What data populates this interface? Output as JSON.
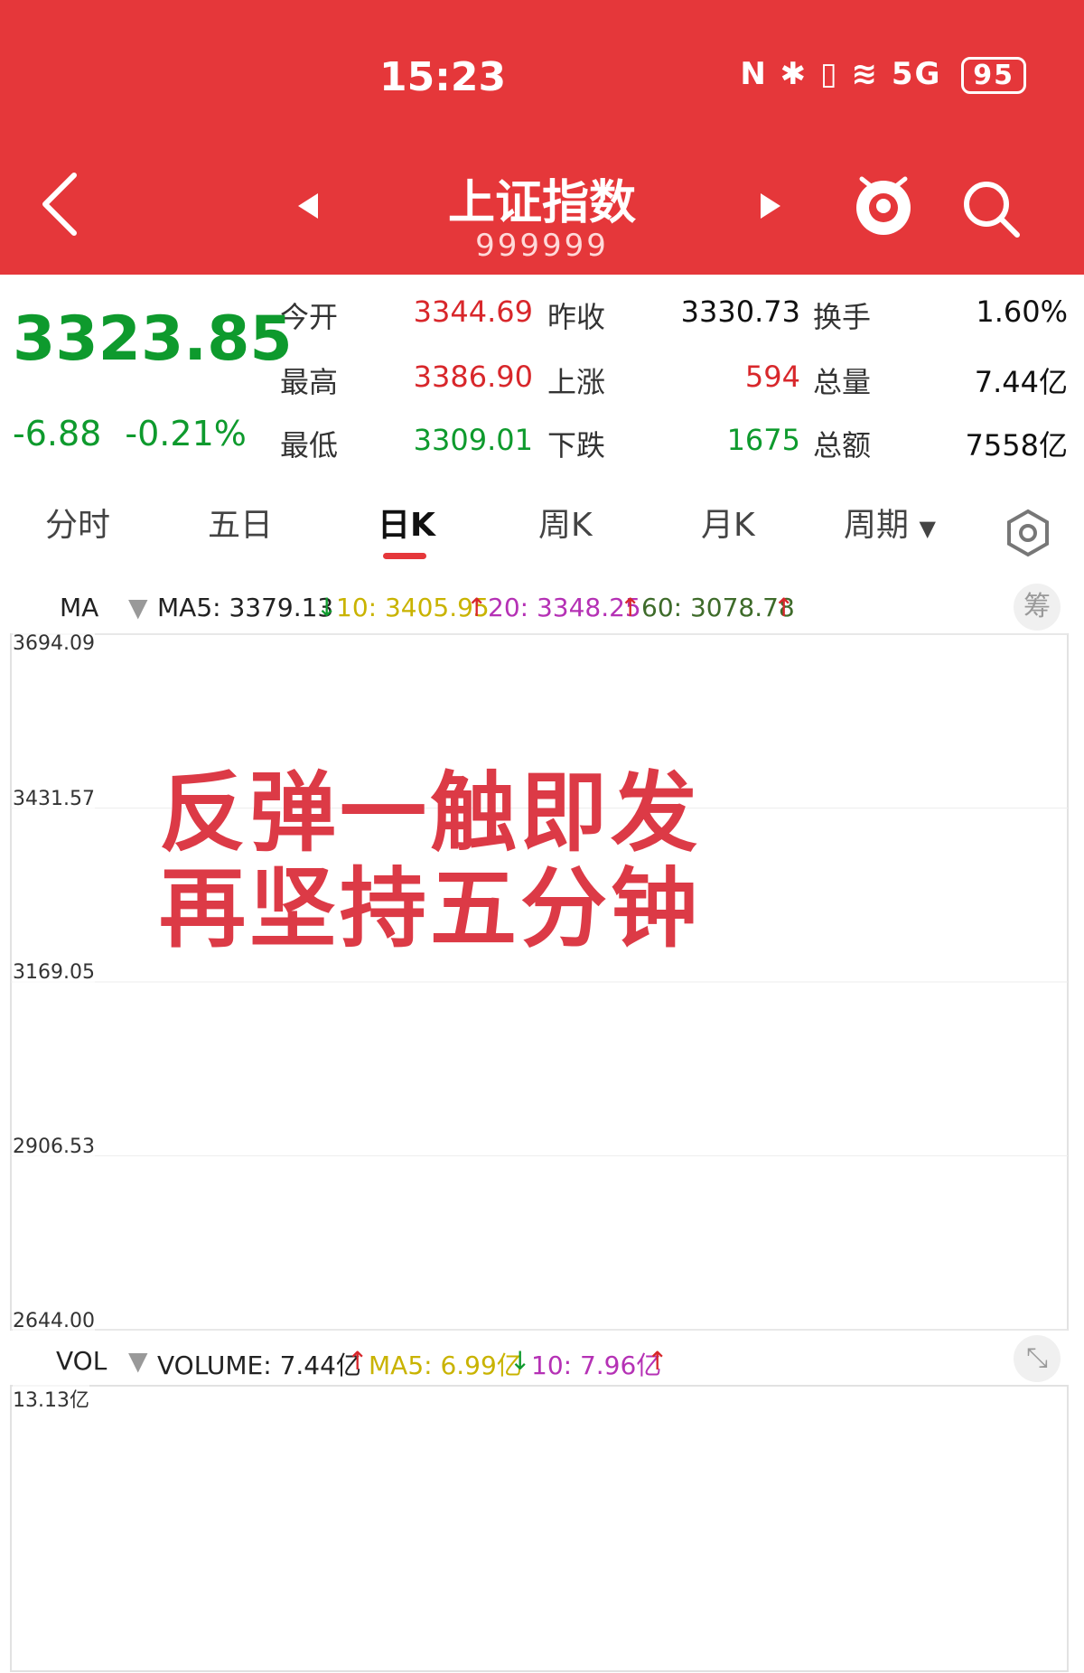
{
  "status": {
    "time": "15:23",
    "icons": "N ✱ ▯ ≋ 5G",
    "battery": "95"
  },
  "header": {
    "title": "上证指数",
    "code": "999999"
  },
  "quote": {
    "price": "3323.85",
    "change": "-6.88",
    "change_pct": "-0.21%"
  },
  "stats": [
    {
      "label": "今开",
      "value": "3344.69",
      "color": "red"
    },
    {
      "label": "昨收",
      "value": "3330.73",
      "color": "black"
    },
    {
      "label": "换手",
      "value": "1.60%",
      "color": "black"
    },
    {
      "label": "最高",
      "value": "3386.90",
      "color": "red"
    },
    {
      "label": "上涨",
      "value": "594",
      "color": "red"
    },
    {
      "label": "总量",
      "value": "7.44亿",
      "color": "black"
    },
    {
      "label": "最低",
      "value": "3309.01",
      "color": "green"
    },
    {
      "label": "下跌",
      "value": "1675",
      "color": "green"
    },
    {
      "label": "总额",
      "value": "7558亿",
      "color": "black"
    }
  ],
  "tabs": [
    "分时",
    "五日",
    "日K",
    "周K",
    "月K",
    "周期"
  ],
  "active_tab": "日K",
  "ma_row": {
    "label": "MA",
    "ma5": "MA5: 3379.13",
    "ma10": "10: 3405.95",
    "ma20": "20: 3348.25",
    "ma60": "60: 3078.78",
    "chip": "筹"
  },
  "vol_row": {
    "label": "VOL",
    "volume": "VOLUME: 7.44亿",
    "ma5": "MA5: 6.99亿",
    "ma10": "10: 7.96亿"
  },
  "overlay": {
    "line1": "反弹一触即发",
    "line2": "再坚持五分钟"
  },
  "colors": {
    "up": "#d8272b",
    "down": "#0e9a2d",
    "ma5": "#222222",
    "ma10": "#c9b300",
    "ma20": "#b531b5",
    "ma60": "#3e6b2a",
    "header": "#e5373a"
  },
  "chart_data": {
    "type": "candlestick",
    "price_axis": {
      "ticks": [
        "3694.09",
        "3431.57",
        "3169.05",
        "2906.53",
        "2644.00"
      ],
      "ylim": [
        2644.0,
        3694.09
      ]
    },
    "volume_axis": {
      "max_label": "13.13亿",
      "ylim": [
        0,
        13.13
      ]
    },
    "candles": [],
    "volumes": []
  }
}
